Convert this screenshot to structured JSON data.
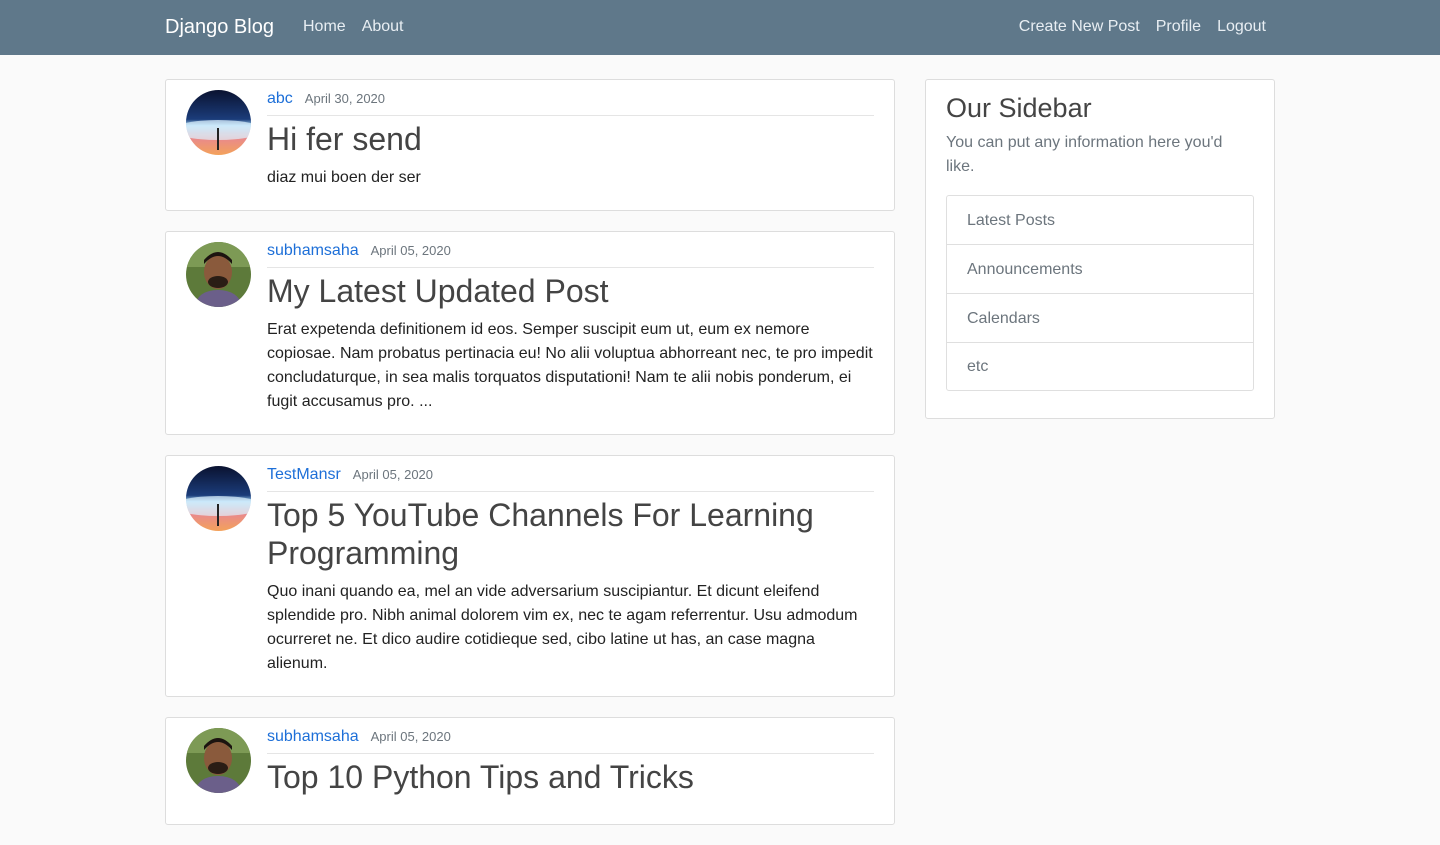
{
  "navbar": {
    "brand": "Django Blog",
    "left_links": [
      "Home",
      "About"
    ],
    "right_links": [
      "Create New Post",
      "Profile",
      "Logout"
    ],
    "background_color": "#5f788a"
  },
  "posts": [
    {
      "author": "abc",
      "date": "April 30, 2020",
      "title": "Hi fer send",
      "body": "diaz mui boen der ser",
      "avatar": "earth-horizon-avatar"
    },
    {
      "author": "subhamsaha",
      "date": "April 05, 2020",
      "title": "My Latest Updated Post",
      "body": "Erat expetenda definitionem id eos. Semper suscipit eum ut, eum ex nemore copiosae. Nam probatus pertinacia eu! No alii voluptua abhorreant nec, te pro impedit concludaturque, in sea malis torquatos disputationi! Nam te alii nobis ponderum, ei fugit accusamus pro. ...",
      "avatar": "person-photo-avatar"
    },
    {
      "author": "TestMansr",
      "date": "April 05, 2020",
      "title": "Top 5 YouTube Channels For Learning Programming",
      "body": "Quo inani quando ea, mel an vide adversarium suscipiantur. Et dicunt eleifend splendide pro. Nibh animal dolorem vim ex, nec te agam referrentur. Usu admodum ocurreret ne. Et dico audire cotidieque sed, cibo latine ut has, an case magna alienum.",
      "avatar": "earth-horizon-avatar"
    },
    {
      "author": "subhamsaha",
      "date": "April 05, 2020",
      "title": "Top 10 Python Tips and Tricks",
      "body": "",
      "avatar": "person-photo-avatar"
    }
  ],
  "sidebar": {
    "title": "Our Sidebar",
    "description": "You can put any information here you'd like.",
    "items": [
      "Latest Posts",
      "Announcements",
      "Calendars",
      "etc"
    ]
  },
  "colors": {
    "accent_link": "#1d6fd8",
    "muted_text": "#6c757d"
  }
}
